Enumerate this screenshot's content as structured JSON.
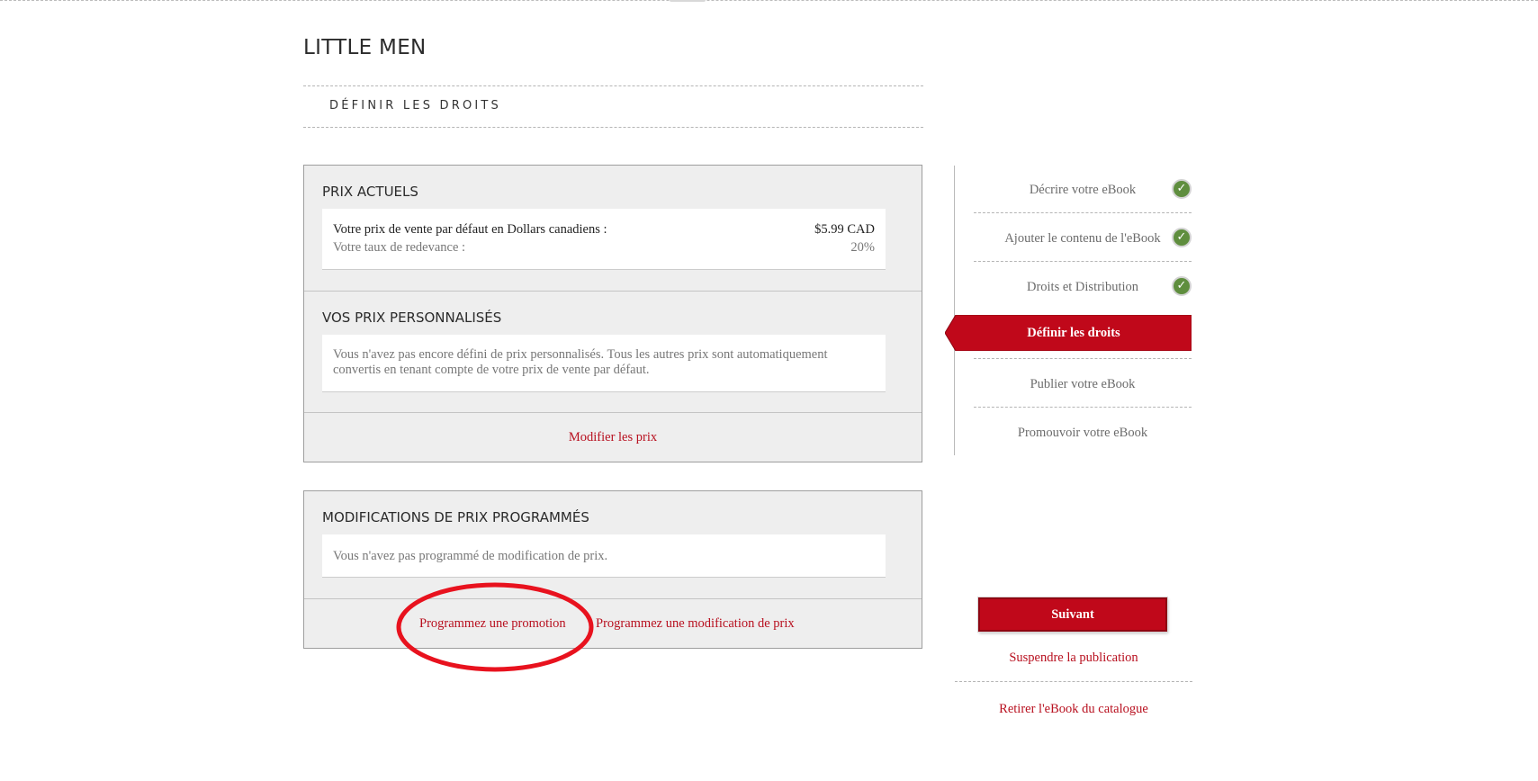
{
  "book": {
    "title": "LITTLE MEN"
  },
  "page": {
    "section_title": "DÉFINIR LES DROITS"
  },
  "current_prices": {
    "heading": "PRIX ACTUELS",
    "default_price_label": "Votre prix de vente par défaut en Dollars canadiens :",
    "default_price_value": "$5.99 CAD",
    "royalty_label": "Votre taux de redevance :",
    "royalty_value": "20%"
  },
  "custom_prices": {
    "heading": "VOS PRIX PERSONNALISÉS",
    "message_line1": "Vous n'avez pas encore défini de prix personnalisés. Tous les autres prix sont automatiquement",
    "message_line2": "convertis en tenant compte de votre prix de vente par défaut.",
    "edit_link": "Modifier les prix"
  },
  "scheduled_changes": {
    "heading": "MODIFICATIONS DE PRIX PROGRAMMÉS",
    "message": "Vous n'avez pas programmé de modification de prix.",
    "promo_link": "Programmez une promotion",
    "change_link": "Programmez une modification de prix"
  },
  "steps": {
    "items": [
      {
        "label": "Décrire votre eBook",
        "completed": true
      },
      {
        "label": "Ajouter le contenu de l'eBook",
        "completed": true
      },
      {
        "label": "Droits et Distribution",
        "completed": true
      },
      {
        "label": "Définir les droits",
        "active": true
      },
      {
        "label": "Publier votre eBook",
        "completed": false
      },
      {
        "label": "Promouvoir votre eBook",
        "completed": false
      }
    ]
  },
  "actions": {
    "next_label": "Suivant",
    "suspend_label": "Suspendre la publication",
    "remove_label": "Retirer l'eBook du catalogue"
  },
  "icons": {
    "completed": "check-circle-icon",
    "check_glyph": "✓"
  },
  "colors": {
    "accent_red": "#c0081a",
    "link_red": "#b8101f",
    "check_green": "#5f8e3e",
    "panel_bg": "#eeeeee",
    "annotation_red": "#e8121e"
  }
}
